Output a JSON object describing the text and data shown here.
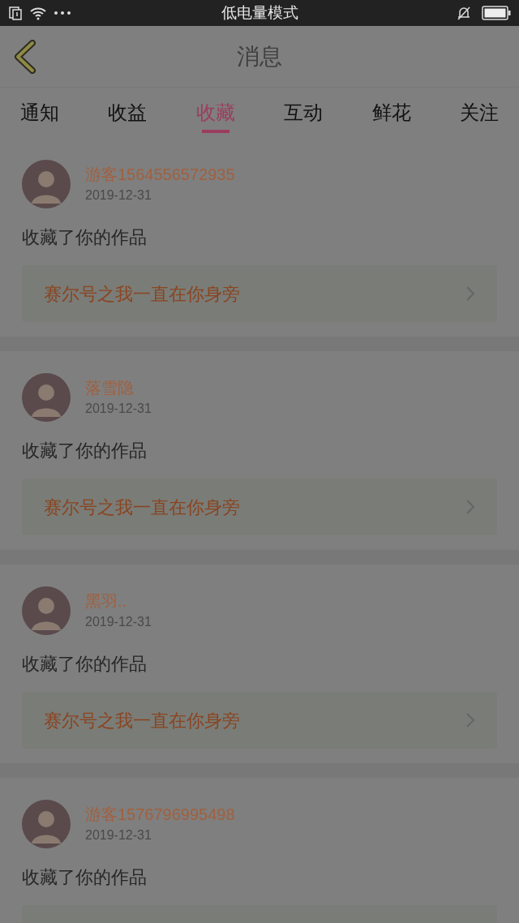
{
  "status_bar": {
    "mode": "低电量模式"
  },
  "header": {
    "title": "消息"
  },
  "tabs": [
    {
      "label": "通知",
      "selected": false
    },
    {
      "label": "收益",
      "selected": false
    },
    {
      "label": "收藏",
      "selected": true
    },
    {
      "label": "互动",
      "selected": false
    },
    {
      "label": "鲜花",
      "selected": false
    },
    {
      "label": "关注",
      "selected": false
    }
  ],
  "messages": [
    {
      "user": "游客1564556572935",
      "date": "2019-12-31",
      "action": "收藏了你的作品",
      "work": "赛尔号之我一直在你身旁"
    },
    {
      "user": "落雪隐",
      "date": "2019-12-31",
      "action": "收藏了你的作品",
      "work": "赛尔号之我一直在你身旁"
    },
    {
      "user": "黑羽..",
      "date": "2019-12-31",
      "action": "收藏了你的作品",
      "work": "赛尔号之我一直在你身旁"
    },
    {
      "user": "游客1576796995498",
      "date": "2019-12-31",
      "action": "收藏了你的作品"
    }
  ]
}
